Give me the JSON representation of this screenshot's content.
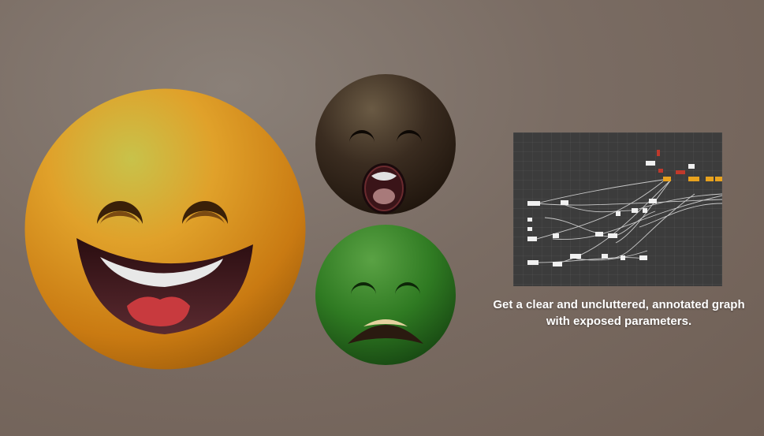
{
  "caption": {
    "line1": "Get a clear and uncluttered, annotated graph",
    "line2": "with exposed parameters."
  },
  "colors": {
    "background": "#7a6c63",
    "happy_face": "#e0a12a",
    "surprised_face": "#3a2c20",
    "sick_face": "#2f7a22",
    "graph_panel": "#3c3c3c",
    "node_accent": "#e8a21e",
    "node_red": "#c0392b"
  },
  "icons": {
    "large": "laughing-face-icon",
    "top_right": "surprised-face-icon",
    "bottom_right": "sick-face-icon"
  }
}
